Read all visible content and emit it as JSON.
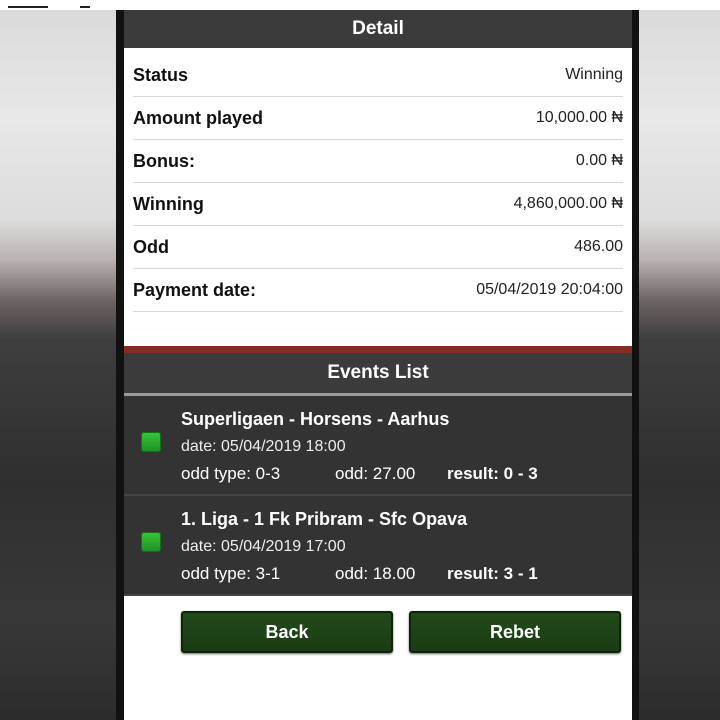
{
  "detail": {
    "header": "Detail",
    "rows": [
      {
        "label": "Status",
        "value": "Winning"
      },
      {
        "label": "Amount played",
        "value": "10,000.00 ₦"
      },
      {
        "label": "Bonus:",
        "value": "0.00 ₦"
      },
      {
        "label": "Winning",
        "value": "4,860,000.00 ₦"
      },
      {
        "label": "Odd",
        "value": "486.00"
      },
      {
        "label": "Payment date:",
        "value": "05/04/2019 20:04:00"
      }
    ]
  },
  "events": {
    "header": "Events List",
    "items": [
      {
        "title": "Superligaen - Horsens - Aarhus",
        "date": "date: 05/04/2019 18:00",
        "odd_type": "odd type: 0-3",
        "odd": "odd: 27.00",
        "result": "result: 0 - 3"
      },
      {
        "title": "1. Liga - 1 Fk Pribram - Sfc Opava",
        "date": "date: 05/04/2019 17:00",
        "odd_type": "odd type: 3-1",
        "odd": "odd: 18.00",
        "result": "result: 3 - 1"
      }
    ]
  },
  "buttons": {
    "back": "Back",
    "rebet": "Rebet"
  },
  "colors": {
    "header_bg": "#3b3b3b",
    "divider_red": "#8b2a23",
    "button_green": "#234a1b",
    "status_green": "#2db531"
  }
}
